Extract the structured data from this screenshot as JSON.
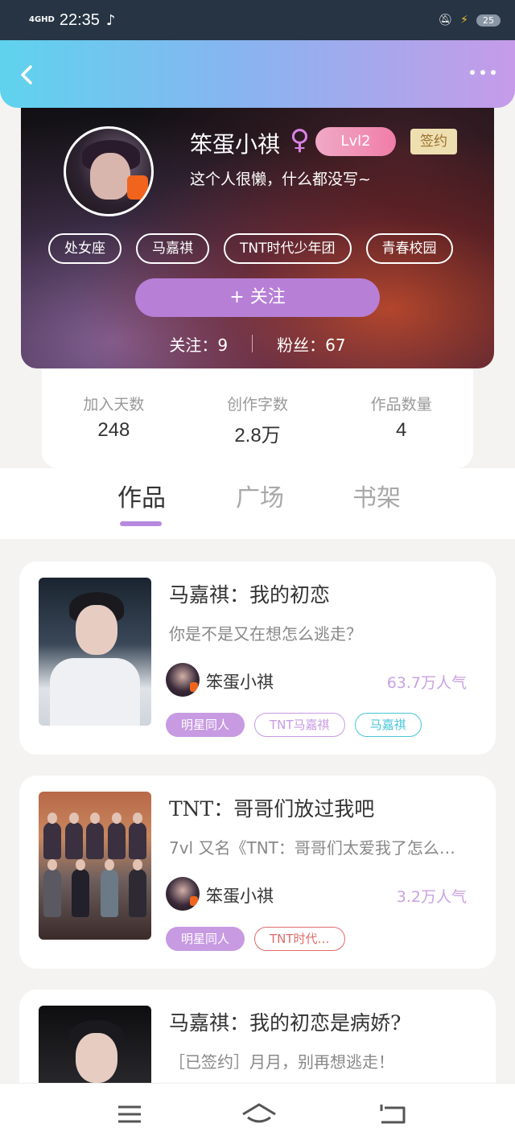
{
  "status_bar": {
    "network": "4GHD",
    "time": "22:35",
    "battery": "25"
  },
  "profile": {
    "username": "笨蛋小祺",
    "gender_symbol": "♀",
    "level": "Lvl2",
    "sign_badge": "签约",
    "bio": "这个人很懒，什么都没写~",
    "tags": [
      "处女座",
      "马嘉祺",
      "TNT时代少年团",
      "青春校园"
    ],
    "follow_button": "+   关注",
    "following_label": "关注：9",
    "fans_label": "粉丝：67"
  },
  "stats": [
    {
      "label": "加入天数",
      "value": "248"
    },
    {
      "label": "创作字数",
      "value": "2.8万"
    },
    {
      "label": "作品数量",
      "value": "4"
    }
  ],
  "tabs": [
    {
      "label": "作品",
      "active": true
    },
    {
      "label": "广场",
      "active": false
    },
    {
      "label": "书架",
      "active": false
    }
  ],
  "works": [
    {
      "title": "马嘉祺：我的初恋",
      "description": "你是不是又在想怎么逃走？",
      "author": "笨蛋小祺",
      "popularity": "63.7万人气",
      "tags": [
        {
          "label": "明星同人",
          "style": "fill"
        },
        {
          "label": "TNT马嘉祺",
          "style": "purple"
        },
        {
          "label": "马嘉祺",
          "style": "teal"
        }
      ]
    },
    {
      "title": "TNT：哥哥们放过我吧",
      "description": "7vl 又名《TNT：哥哥们太爱我了怎么…",
      "author": "笨蛋小祺",
      "popularity": "3.2万人气",
      "tags": [
        {
          "label": "明星同人",
          "style": "fill"
        },
        {
          "label": "TNT时代…",
          "style": "red"
        }
      ]
    },
    {
      "title": "马嘉祺：我的初恋是病娇?",
      "description": "［已签约］月月，别再想逃走！"
    }
  ],
  "icons": {
    "back": "chevron-left-icon",
    "more": "more-dots-icon",
    "nav_menu": "menu-icon",
    "nav_home": "home-icon",
    "nav_back": "back-icon"
  }
}
